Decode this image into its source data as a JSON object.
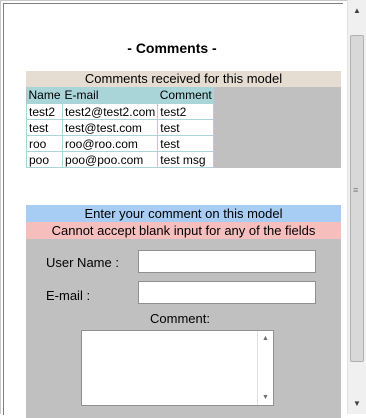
{
  "page": {
    "title": "- Comments -"
  },
  "comments": {
    "header": "Comments received for this model",
    "columns": [
      "Name",
      "E-mail",
      "Comment"
    ],
    "rows": [
      [
        "test2",
        "test2@test2.com",
        "test2"
      ],
      [
        "test",
        "test@test.com",
        "test"
      ],
      [
        "roo",
        "roo@roo.com",
        "test"
      ],
      [
        "poo",
        "poo@poo.com",
        "test msg"
      ]
    ]
  },
  "form": {
    "header": "Enter your comment on this model",
    "error": "Cannot accept blank input for any of the fields",
    "username_label": "User Name :",
    "username_value": "",
    "email_label": "E-mail :",
    "email_value": "",
    "comment_label": "Comment:",
    "comment_value": ""
  },
  "icons": {
    "scroll_up": "up-arrow-icon",
    "scroll_down": "down-arrow-icon",
    "grip": "scroll-grip-icon"
  },
  "colors": {
    "table_header_band": "#e6ddd2",
    "column_header": "#a9d5d9",
    "enter_band": "#a8cdf5",
    "error_band": "#f7bebe",
    "panel_gray": "#c0c0c0"
  }
}
